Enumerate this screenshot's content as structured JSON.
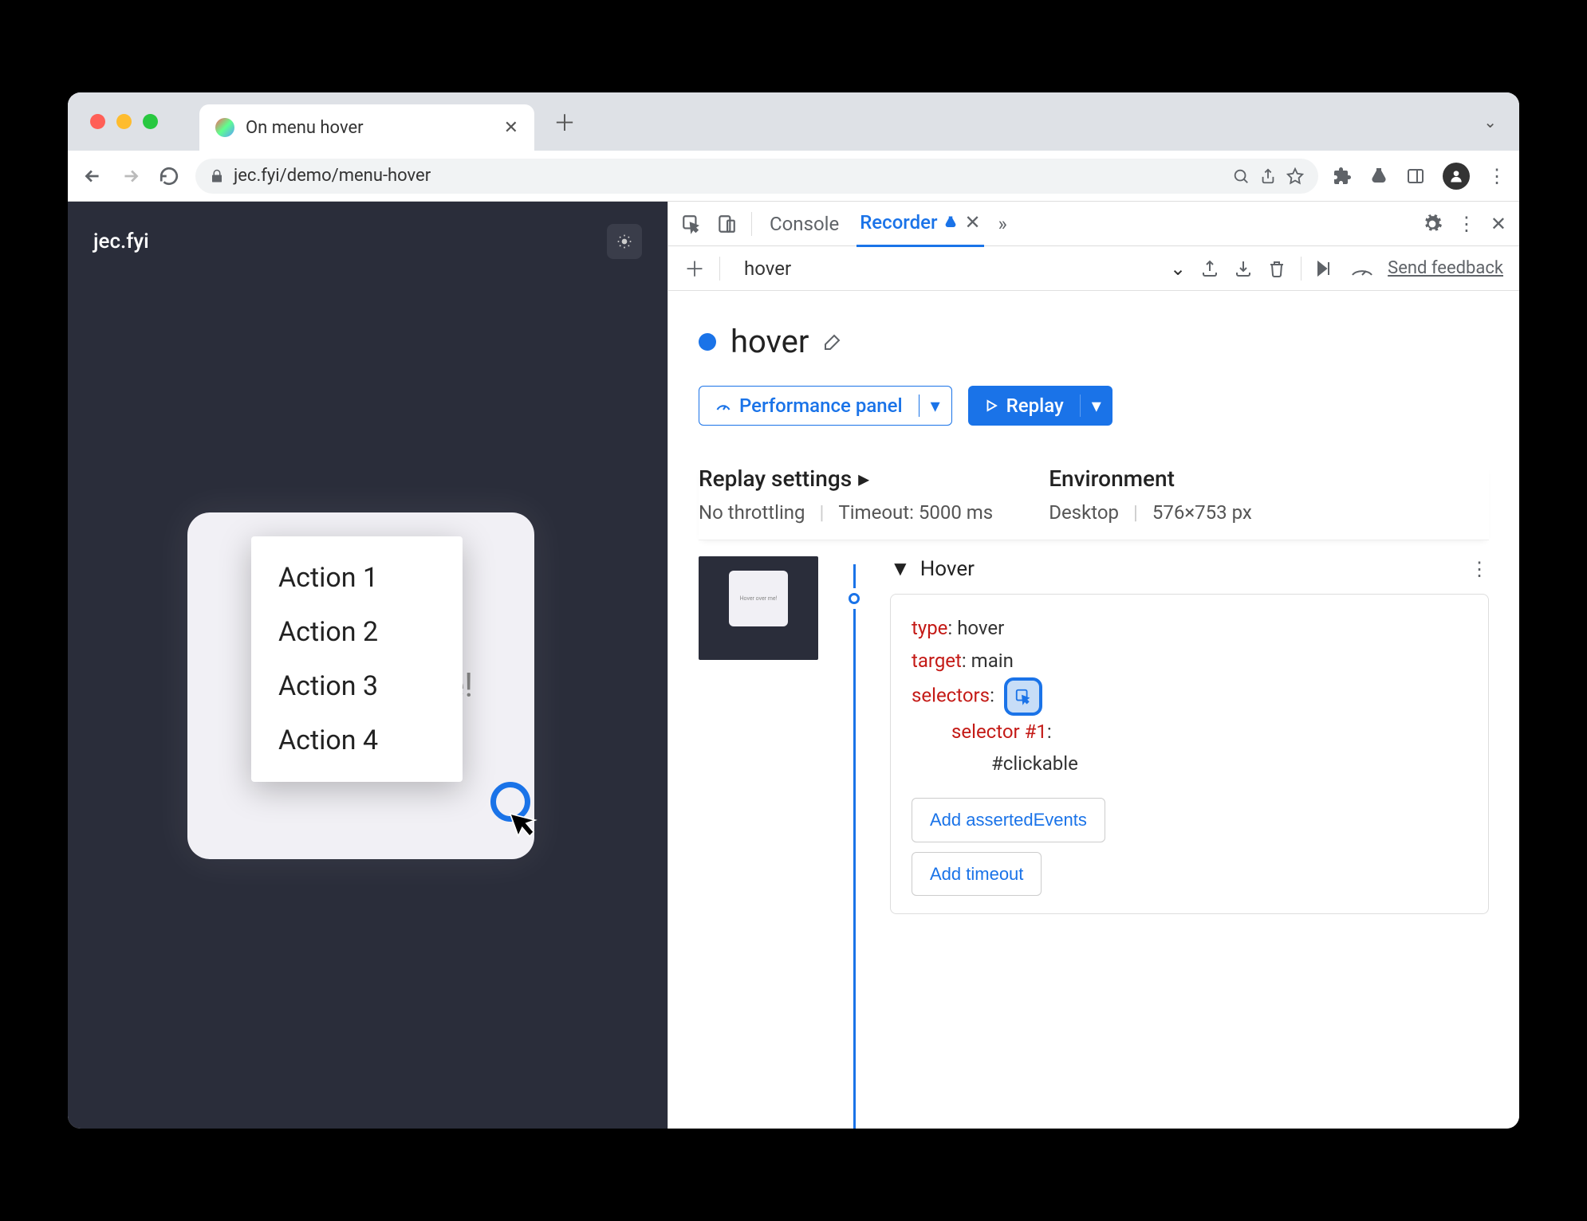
{
  "browser": {
    "tab_title": "On menu hover",
    "url": "jec.fyi/demo/menu-hover"
  },
  "page": {
    "site_name": "jec.fyi",
    "hover_text": "Hover over me!",
    "actions": [
      "Action 1",
      "Action 2",
      "Action 3",
      "Action 4"
    ]
  },
  "devtools": {
    "tabs": {
      "console": "Console",
      "recorder": "Recorder"
    },
    "recorder": {
      "toolbar": {
        "name": "hover",
        "feedback": "Send feedback"
      },
      "title": "hover",
      "buttons": {
        "performance": "Performance panel",
        "replay": "Replay"
      },
      "settings": {
        "replay_title": "Replay settings",
        "throttling": "No throttling",
        "timeout": "Timeout: 5000 ms",
        "env_title": "Environment",
        "env_device": "Desktop",
        "env_viewport": "576×753 px"
      },
      "step": {
        "name": "Hover",
        "thumb_text": "Hover over me!",
        "code": {
          "type_key": "type",
          "type_val": "hover",
          "target_key": "target",
          "target_val": "main",
          "selectors_key": "selectors",
          "selector_label": "selector #1",
          "selector_val": "#clickable"
        },
        "add_asserted": "Add assertedEvents",
        "add_timeout": "Add timeout"
      }
    }
  }
}
